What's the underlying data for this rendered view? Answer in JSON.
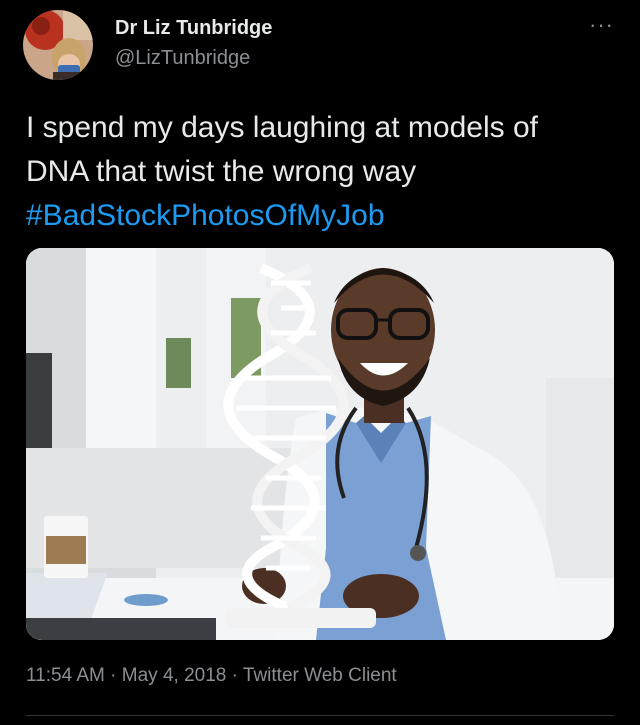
{
  "tweet": {
    "author": {
      "name": "Dr Liz Tunbridge",
      "handle": "@LizTunbridge"
    },
    "more_label": "···",
    "text": {
      "line1": "I spend my days laughing at models of",
      "line2": "DNA that twist the wrong way",
      "hashtag": "#BadStockPhotosOfMyJob"
    },
    "meta": {
      "time": "11:54 AM",
      "separator1": " · ",
      "date": "May 4, 2018",
      "separator2": " · ",
      "source": "Twitter Web Client"
    }
  },
  "colors": {
    "background": "#000000",
    "text": "#e7e9ea",
    "secondary": "#8b8f93",
    "link": "#1d9bf0"
  },
  "icons": {
    "more": "more-icon"
  }
}
